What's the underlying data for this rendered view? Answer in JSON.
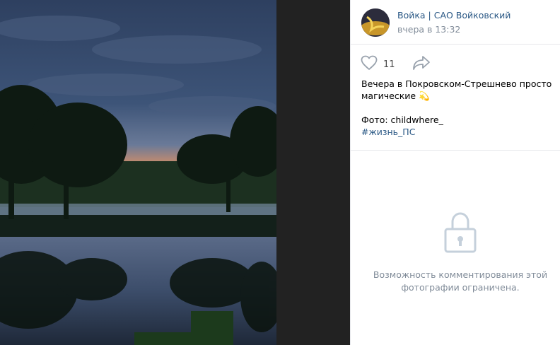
{
  "post": {
    "author": "Войка | САО Войковский",
    "date": "вчера в 13:32",
    "likes_count": "11",
    "text_line1": "Вечера в Покровском-Стрешнево просто",
    "text_line2": "магические",
    "emoji": "💫",
    "photo_credit": "Фото: childwhere_",
    "hashtag": "#жизнь_ПС"
  },
  "comments": {
    "restricted_line1": "Возможность комментирования этой",
    "restricted_line2": "фотографии ограничена."
  },
  "icons": {
    "like": "heart-icon",
    "share": "share-arrow-icon",
    "lock": "lock-icon"
  },
  "colors": {
    "link": "#2a5885",
    "muted": "#818c99",
    "dark_bg": "#222222"
  }
}
